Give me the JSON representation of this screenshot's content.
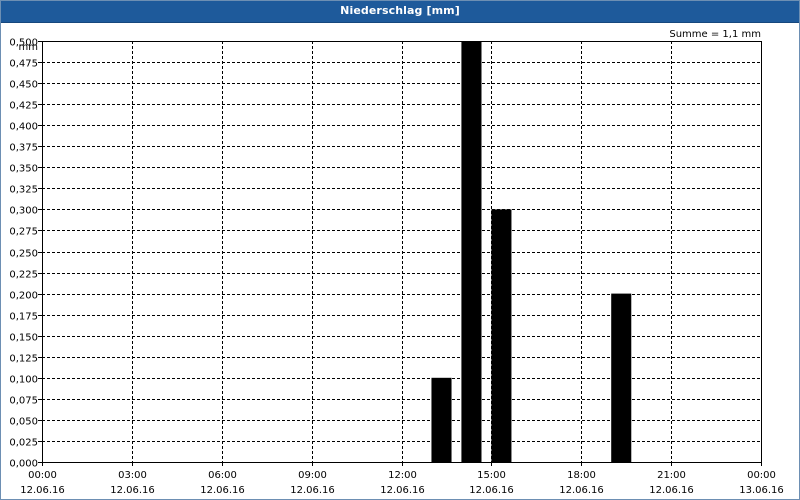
{
  "window": {
    "title": "Niederschlag [mm]"
  },
  "chart_data": {
    "type": "bar",
    "title": "Niederschlag [mm]",
    "ylabel": "mm",
    "annotation": "Summe = 1,1 mm",
    "ylim": [
      0,
      0.5
    ],
    "y_ticks": [
      "0,000",
      "0,025",
      "0,050",
      "0,075",
      "0,100",
      "0,125",
      "0,150",
      "0,175",
      "0,200",
      "0,225",
      "0,250",
      "0,275",
      "0,300",
      "0,325",
      "0,350",
      "0,375",
      "0,400",
      "0,425",
      "0,450",
      "0,475",
      "0,500"
    ],
    "x_ticks": [
      {
        "time": "00:00",
        "date": "12.06.16"
      },
      {
        "time": "03:00",
        "date": "12.06.16"
      },
      {
        "time": "06:00",
        "date": "12.06.16"
      },
      {
        "time": "09:00",
        "date": "12.06.16"
      },
      {
        "time": "12:00",
        "date": "12.06.16"
      },
      {
        "time": "15:00",
        "date": "12.06.16"
      },
      {
        "time": "18:00",
        "date": "12.06.16"
      },
      {
        "time": "21:00",
        "date": "12.06.16"
      },
      {
        "time": "00:00",
        "date": "13.06.16"
      }
    ],
    "xlim": [
      "12.06.16 00:00",
      "13.06.16 00:00"
    ],
    "bar_width_hours": 0.67,
    "bars": [
      {
        "time": "12.06.16 13:00",
        "value": 0.1
      },
      {
        "time": "12.06.16 14:00",
        "value": 0.5
      },
      {
        "time": "12.06.16 15:00",
        "value": 0.3
      },
      {
        "time": "12.06.16 19:00",
        "value": 0.2
      }
    ],
    "grid": true,
    "bar_color": "#000000"
  }
}
